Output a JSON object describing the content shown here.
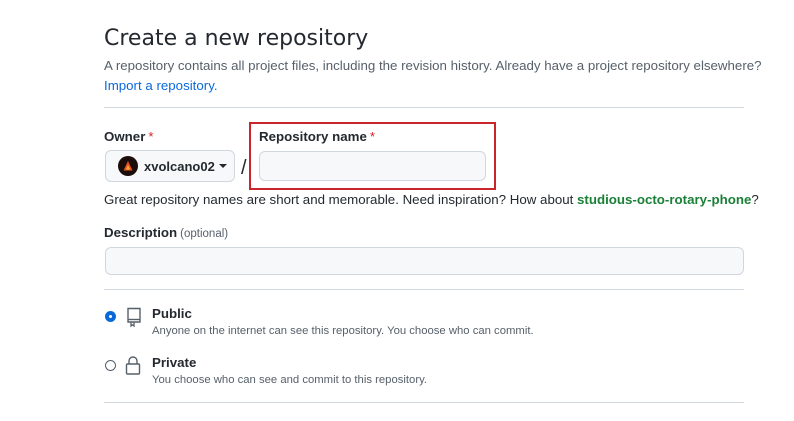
{
  "page": {
    "title": "Create a new repository",
    "subtitle": "A repository contains all project files, including the revision history. Already have a project repository elsewhere?",
    "import_link": "Import a repository."
  },
  "owner": {
    "label": "Owner",
    "required_mark": "*",
    "selected": "xvolcano02",
    "avatar_icon": "avatar-image"
  },
  "separator": "/",
  "repo_name": {
    "label": "Repository name",
    "required_mark": "*",
    "value": "",
    "placeholder": ""
  },
  "hint": {
    "text": "Great repository names are short and memorable. Need inspiration? How about",
    "suggestion": "studious-octo-rotary-phone",
    "suffix": "?"
  },
  "description": {
    "label": "Description",
    "optional": "(optional)",
    "value": "",
    "placeholder": ""
  },
  "visibility": [
    {
      "id": "public",
      "title": "Public",
      "desc": "Anyone on the internet can see this repository. You choose who can commit.",
      "icon": "repo-icon",
      "checked": true
    },
    {
      "id": "private",
      "title": "Private",
      "desc": "You choose who can see and commit to this repository.",
      "icon": "lock-icon",
      "checked": false
    }
  ],
  "colors": {
    "link": "#0969da",
    "required": "#cf222e",
    "suggestion": "#1a7f37",
    "highlight_box": "#c9252c"
  }
}
